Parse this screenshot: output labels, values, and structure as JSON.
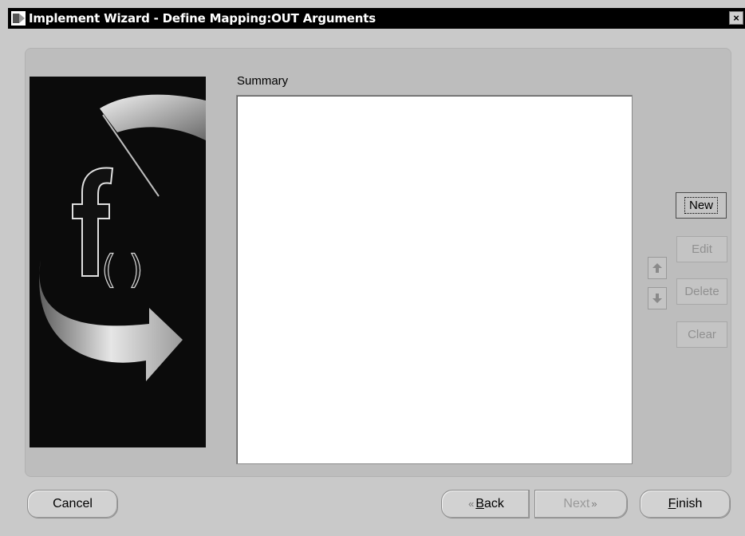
{
  "window": {
    "title": "Implement Wizard - Define Mapping:OUT Arguments",
    "close_label": "×"
  },
  "summary": {
    "label": "Summary"
  },
  "side_buttons": {
    "new": "New",
    "edit": "Edit",
    "delete": "Delete",
    "clear": "Clear"
  },
  "footer": {
    "cancel": "Cancel",
    "back_rest": "ack",
    "back_mnemonic": "B",
    "next": "Next",
    "finish_mnemonic": "F",
    "finish_rest": "inish"
  },
  "icons": {
    "up": "up-arrow-icon",
    "down": "down-arrow-icon",
    "back_chevron": "chevron-left-icon",
    "next_chevron": "chevron-right-icon",
    "image": "function-f-icon"
  },
  "colors": {
    "titlebar": "#000000",
    "panel": "#bdbdbd",
    "background": "#c9c9c9",
    "list": "#ffffff"
  }
}
